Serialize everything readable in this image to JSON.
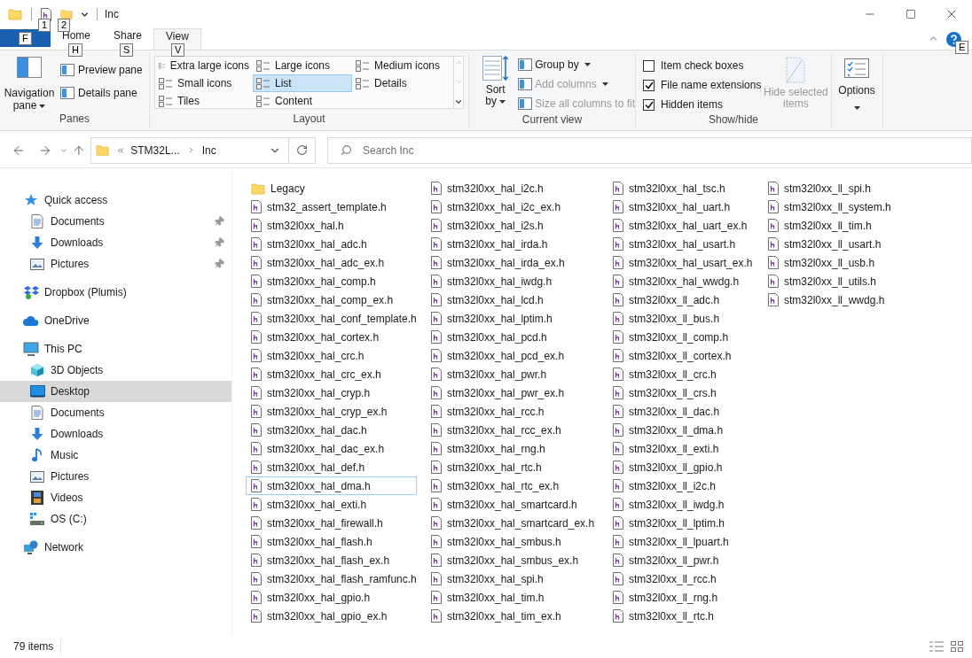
{
  "window": {
    "title": "Inc",
    "quick_keytips": [
      "1",
      "2"
    ]
  },
  "ribbon": {
    "file_keytip": "F",
    "help_keytip": "E",
    "tabs": [
      {
        "label": "Home",
        "keytip": "H",
        "selected": false
      },
      {
        "label": "Share",
        "keytip": "S",
        "selected": false
      },
      {
        "label": "View",
        "keytip": "V",
        "selected": true
      }
    ],
    "panes": {
      "label": "Panes",
      "navigation": "Navigation pane",
      "items": [
        "Preview pane",
        "Details pane"
      ]
    },
    "layout": {
      "label": "Layout",
      "options": [
        {
          "label": "Extra large icons",
          "selected": false
        },
        {
          "label": "Large icons",
          "selected": false
        },
        {
          "label": "Medium icons",
          "selected": false
        },
        {
          "label": "Small icons",
          "selected": false
        },
        {
          "label": "List",
          "selected": true
        },
        {
          "label": "Details",
          "selected": false
        },
        {
          "label": "Tiles",
          "selected": false
        },
        {
          "label": "Content",
          "selected": false
        }
      ]
    },
    "current_view": {
      "label": "Current view",
      "sort": "Sort by",
      "items": [
        {
          "label": "Group by",
          "disabled": false
        },
        {
          "label": "Add columns",
          "disabled": true
        },
        {
          "label": "Size all columns to fit",
          "disabled": true
        }
      ]
    },
    "show_hide": {
      "label": "Show/hide",
      "checkboxes": [
        {
          "label": "Item check boxes",
          "checked": false
        },
        {
          "label": "File name extensions",
          "checked": true
        },
        {
          "label": "Hidden items",
          "checked": true
        }
      ],
      "hide_selected": {
        "label": "Hide selected items",
        "disabled": true
      }
    },
    "options": {
      "label": "Options"
    }
  },
  "address": {
    "path": [
      "STM32L...",
      "Inc"
    ],
    "search_placeholder": "Search Inc"
  },
  "sidebar": {
    "items": [
      {
        "label": "Quick access",
        "kind": "star",
        "selected": false,
        "children": [
          {
            "label": "Documents",
            "kind": "documents",
            "pinned": true,
            "selected": false
          },
          {
            "label": "Downloads",
            "kind": "downloads",
            "pinned": true,
            "selected": false
          },
          {
            "label": "Pictures",
            "kind": "pictures",
            "pinned": true,
            "selected": false
          }
        ]
      },
      {
        "label": "Dropbox (Plumis)",
        "kind": "dropbox",
        "selected": false
      },
      {
        "label": "OneDrive",
        "kind": "cloud",
        "selected": false
      },
      {
        "label": "This PC",
        "kind": "pc",
        "selected": false,
        "children": [
          {
            "label": "3D Objects",
            "kind": "cube",
            "pinned": false,
            "selected": false
          },
          {
            "label": "Desktop",
            "kind": "desktop",
            "pinned": false,
            "selected": true
          },
          {
            "label": "Documents",
            "kind": "documents",
            "pinned": false,
            "selected": false
          },
          {
            "label": "Downloads",
            "kind": "downloads",
            "pinned": false,
            "selected": false
          },
          {
            "label": "Music",
            "kind": "music",
            "pinned": false,
            "selected": false
          },
          {
            "label": "Pictures",
            "kind": "pictures",
            "pinned": false,
            "selected": false
          },
          {
            "label": "Videos",
            "kind": "videos",
            "pinned": false,
            "selected": false
          },
          {
            "label": "OS (C:)",
            "kind": "drive",
            "pinned": false,
            "selected": false
          }
        ]
      },
      {
        "label": "Network",
        "kind": "network",
        "selected": false
      }
    ]
  },
  "files": [
    {
      "name": "Legacy",
      "kind": "folder",
      "focused": false
    },
    {
      "name": "stm32_assert_template.h",
      "kind": "file",
      "focused": false
    },
    {
      "name": "stm32l0xx_hal.h",
      "kind": "file",
      "focused": false
    },
    {
      "name": "stm32l0xx_hal_adc.h",
      "kind": "file",
      "focused": false
    },
    {
      "name": "stm32l0xx_hal_adc_ex.h",
      "kind": "file",
      "focused": false
    },
    {
      "name": "stm32l0xx_hal_comp.h",
      "kind": "file",
      "focused": false
    },
    {
      "name": "stm32l0xx_hal_comp_ex.h",
      "kind": "file",
      "focused": false
    },
    {
      "name": "stm32l0xx_hal_conf_template.h",
      "kind": "file",
      "focused": false
    },
    {
      "name": "stm32l0xx_hal_cortex.h",
      "kind": "file",
      "focused": false
    },
    {
      "name": "stm32l0xx_hal_crc.h",
      "kind": "file",
      "focused": false
    },
    {
      "name": "stm32l0xx_hal_crc_ex.h",
      "kind": "file",
      "focused": false
    },
    {
      "name": "stm32l0xx_hal_cryp.h",
      "kind": "file",
      "focused": false
    },
    {
      "name": "stm32l0xx_hal_cryp_ex.h",
      "kind": "file",
      "focused": false
    },
    {
      "name": "stm32l0xx_hal_dac.h",
      "kind": "file",
      "focused": false
    },
    {
      "name": "stm32l0xx_hal_dac_ex.h",
      "kind": "file",
      "focused": false
    },
    {
      "name": "stm32l0xx_hal_def.h",
      "kind": "file",
      "focused": false
    },
    {
      "name": "stm32l0xx_hal_dma.h",
      "kind": "file",
      "focused": true
    },
    {
      "name": "stm32l0xx_hal_exti.h",
      "kind": "file",
      "focused": false
    },
    {
      "name": "stm32l0xx_hal_firewall.h",
      "kind": "file",
      "focused": false
    },
    {
      "name": "stm32l0xx_hal_flash.h",
      "kind": "file",
      "focused": false
    },
    {
      "name": "stm32l0xx_hal_flash_ex.h",
      "kind": "file",
      "focused": false
    },
    {
      "name": "stm32l0xx_hal_flash_ramfunc.h",
      "kind": "file",
      "focused": false
    },
    {
      "name": "stm32l0xx_hal_gpio.h",
      "kind": "file",
      "focused": false
    },
    {
      "name": "stm32l0xx_hal_gpio_ex.h",
      "kind": "file",
      "focused": false
    },
    {
      "name": "stm32l0xx_hal_i2c.h",
      "kind": "file",
      "focused": false
    },
    {
      "name": "stm32l0xx_hal_i2c_ex.h",
      "kind": "file",
      "focused": false
    },
    {
      "name": "stm32l0xx_hal_i2s.h",
      "kind": "file",
      "focused": false
    },
    {
      "name": "stm32l0xx_hal_irda.h",
      "kind": "file",
      "focused": false
    },
    {
      "name": "stm32l0xx_hal_irda_ex.h",
      "kind": "file",
      "focused": false
    },
    {
      "name": "stm32l0xx_hal_iwdg.h",
      "kind": "file",
      "focused": false
    },
    {
      "name": "stm32l0xx_hal_lcd.h",
      "kind": "file",
      "focused": false
    },
    {
      "name": "stm32l0xx_hal_lptim.h",
      "kind": "file",
      "focused": false
    },
    {
      "name": "stm32l0xx_hal_pcd.h",
      "kind": "file",
      "focused": false
    },
    {
      "name": "stm32l0xx_hal_pcd_ex.h",
      "kind": "file",
      "focused": false
    },
    {
      "name": "stm32l0xx_hal_pwr.h",
      "kind": "file",
      "focused": false
    },
    {
      "name": "stm32l0xx_hal_pwr_ex.h",
      "kind": "file",
      "focused": false
    },
    {
      "name": "stm32l0xx_hal_rcc.h",
      "kind": "file",
      "focused": false
    },
    {
      "name": "stm32l0xx_hal_rcc_ex.h",
      "kind": "file",
      "focused": false
    },
    {
      "name": "stm32l0xx_hal_rng.h",
      "kind": "file",
      "focused": false
    },
    {
      "name": "stm32l0xx_hal_rtc.h",
      "kind": "file",
      "focused": false
    },
    {
      "name": "stm32l0xx_hal_rtc_ex.h",
      "kind": "file",
      "focused": false
    },
    {
      "name": "stm32l0xx_hal_smartcard.h",
      "kind": "file",
      "focused": false
    },
    {
      "name": "stm32l0xx_hal_smartcard_ex.h",
      "kind": "file",
      "focused": false
    },
    {
      "name": "stm32l0xx_hal_smbus.h",
      "kind": "file",
      "focused": false
    },
    {
      "name": "stm32l0xx_hal_smbus_ex.h",
      "kind": "file",
      "focused": false
    },
    {
      "name": "stm32l0xx_hal_spi.h",
      "kind": "file",
      "focused": false
    },
    {
      "name": "stm32l0xx_hal_tim.h",
      "kind": "file",
      "focused": false
    },
    {
      "name": "stm32l0xx_hal_tim_ex.h",
      "kind": "file",
      "focused": false
    },
    {
      "name": "stm32l0xx_hal_tsc.h",
      "kind": "file",
      "focused": false
    },
    {
      "name": "stm32l0xx_hal_uart.h",
      "kind": "file",
      "focused": false
    },
    {
      "name": "stm32l0xx_hal_uart_ex.h",
      "kind": "file",
      "focused": false
    },
    {
      "name": "stm32l0xx_hal_usart.h",
      "kind": "file",
      "focused": false
    },
    {
      "name": "stm32l0xx_hal_usart_ex.h",
      "kind": "file",
      "focused": false
    },
    {
      "name": "stm32l0xx_hal_wwdg.h",
      "kind": "file",
      "focused": false
    },
    {
      "name": "stm32l0xx_ll_adc.h",
      "kind": "file",
      "focused": false
    },
    {
      "name": "stm32l0xx_ll_bus.h",
      "kind": "file",
      "focused": false
    },
    {
      "name": "stm32l0xx_ll_comp.h",
      "kind": "file",
      "focused": false
    },
    {
      "name": "stm32l0xx_ll_cortex.h",
      "kind": "file",
      "focused": false
    },
    {
      "name": "stm32l0xx_ll_crc.h",
      "kind": "file",
      "focused": false
    },
    {
      "name": "stm32l0xx_ll_crs.h",
      "kind": "file",
      "focused": false
    },
    {
      "name": "stm32l0xx_ll_dac.h",
      "kind": "file",
      "focused": false
    },
    {
      "name": "stm32l0xx_ll_dma.h",
      "kind": "file",
      "focused": false
    },
    {
      "name": "stm32l0xx_ll_exti.h",
      "kind": "file",
      "focused": false
    },
    {
      "name": "stm32l0xx_ll_gpio.h",
      "kind": "file",
      "focused": false
    },
    {
      "name": "stm32l0xx_ll_i2c.h",
      "kind": "file",
      "focused": false
    },
    {
      "name": "stm32l0xx_ll_iwdg.h",
      "kind": "file",
      "focused": false
    },
    {
      "name": "stm32l0xx_ll_lptim.h",
      "kind": "file",
      "focused": false
    },
    {
      "name": "stm32l0xx_ll_lpuart.h",
      "kind": "file",
      "focused": false
    },
    {
      "name": "stm32l0xx_ll_pwr.h",
      "kind": "file",
      "focused": false
    },
    {
      "name": "stm32l0xx_ll_rcc.h",
      "kind": "file",
      "focused": false
    },
    {
      "name": "stm32l0xx_ll_rng.h",
      "kind": "file",
      "focused": false
    },
    {
      "name": "stm32l0xx_ll_rtc.h",
      "kind": "file",
      "focused": false
    },
    {
      "name": "stm32l0xx_ll_spi.h",
      "kind": "file",
      "focused": false
    },
    {
      "name": "stm32l0xx_ll_system.h",
      "kind": "file",
      "focused": false
    },
    {
      "name": "stm32l0xx_ll_tim.h",
      "kind": "file",
      "focused": false
    },
    {
      "name": "stm32l0xx_ll_usart.h",
      "kind": "file",
      "focused": false
    },
    {
      "name": "stm32l0xx_ll_usb.h",
      "kind": "file",
      "focused": false
    },
    {
      "name": "stm32l0xx_ll_utils.h",
      "kind": "file",
      "focused": false
    },
    {
      "name": "stm32l0xx_ll_wwdg.h",
      "kind": "file",
      "focused": false
    }
  ],
  "status_bar": {
    "count": "79 items"
  }
}
